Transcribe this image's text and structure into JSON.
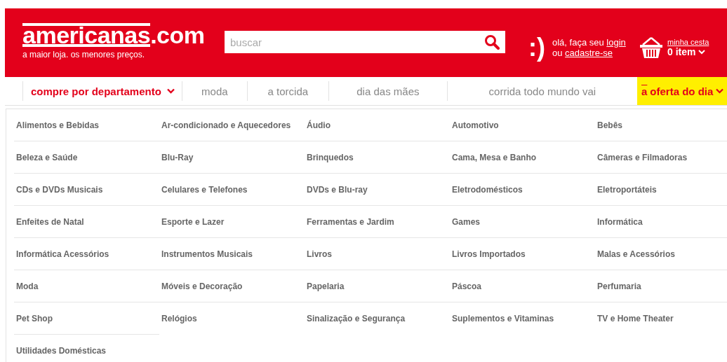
{
  "header": {
    "logo": {
      "name": "americanas",
      ".com": ".com",
      "tagline": "a maior loja. os menores preços."
    },
    "search": {
      "placeholder": "buscar"
    },
    "account": {
      "smiley": ":)",
      "greeting": "olá, faça seu",
      "login": "login",
      "or": "ou",
      "signup": "cadastre-se"
    },
    "cart": {
      "label": "minha cesta",
      "count": "0 item"
    }
  },
  "nav": {
    "items": [
      {
        "label": "compre por departamento",
        "kind": "dropdown",
        "expanded": true
      },
      {
        "label": "moda",
        "kind": "link"
      },
      {
        "label": "a torcida",
        "kind": "link"
      },
      {
        "label": "dia das mães",
        "kind": "link"
      },
      {
        "label": "corrida todo mundo vai",
        "kind": "link"
      }
    ],
    "offer": {
      "mark": "a",
      "label": "oferta do dia"
    }
  },
  "departments": [
    "Alimentos e Bebidas",
    "Ar-condicionado e Aquecedores",
    "Áudio",
    "Automotivo",
    "Bebês",
    "Beleza e Saúde",
    "Blu-Ray",
    "Brinquedos",
    "Cama, Mesa e Banho",
    "Câmeras e Filmadoras",
    "CDs e DVDs Musicais",
    "Celulares e Telefones",
    "DVDs e Blu-ray",
    "Eletrodomésticos",
    "Eletroportáteis",
    "Enfeites de Natal",
    "Esporte e Lazer",
    "Ferramentas e Jardim",
    "Games",
    "Informática",
    "Informática Acessórios",
    "Instrumentos Musicais",
    "Livros",
    "Livros Importados",
    "Malas e Acessórios",
    "Moda",
    "Móveis e Decoração",
    "Papelaria",
    "Páscoa",
    "Perfumaria",
    "Pet Shop",
    "Relógios",
    "Sinalização e Segurança",
    "Suplementos e Vitaminas",
    "TV e Home Theater",
    "Utilidades Domésticas"
  ]
}
